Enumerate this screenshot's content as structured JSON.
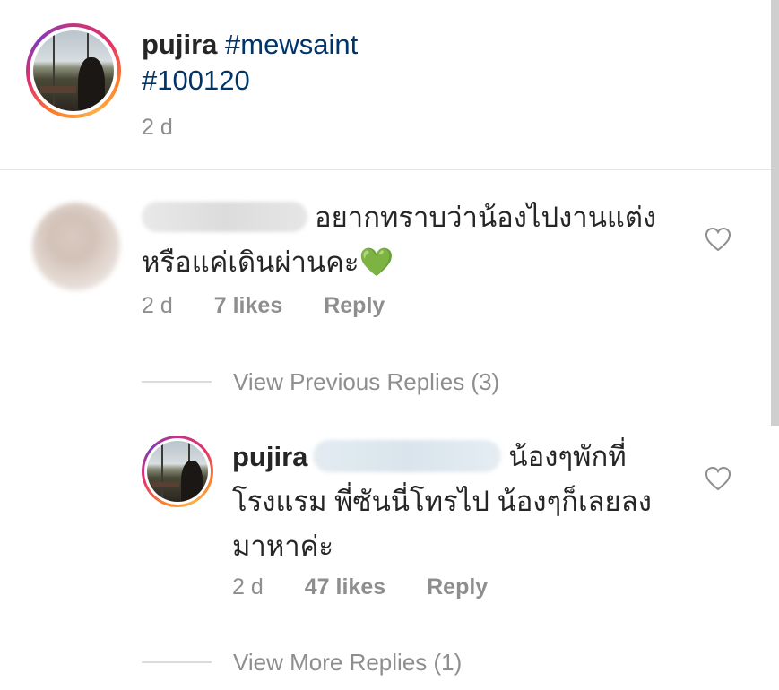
{
  "caption": {
    "username": "pujira",
    "hashtag_1": "#mewsaint",
    "hashtag_2": "#100120",
    "time": "2 d"
  },
  "comments": [
    {
      "username_blurred": true,
      "text": "อยากทราบว่าน้องไปงานแต่งหรือแค่เดินผ่านคะ💚",
      "time": "2 d",
      "likes": "7 likes",
      "reply_label": "Reply",
      "view_previous_replies": "View Previous Replies (3)",
      "replies": [
        {
          "username": "pujira",
          "mention_blurred": true,
          "text": "น้องๆพักที่โรงแรม พี่ซันนี่โทรไป น้องๆก็เลยลงมาหาค่ะ",
          "time": "2 d",
          "likes": "47 likes",
          "reply_label": "Reply"
        }
      ],
      "view_more_replies": "View More Replies (1)"
    }
  ],
  "icons": {
    "like": "heart-outline-icon"
  },
  "colors": {
    "hashtag": "#003569",
    "meta": "#8e8e8e",
    "text": "#262626",
    "story_ring": "#e1306c"
  }
}
